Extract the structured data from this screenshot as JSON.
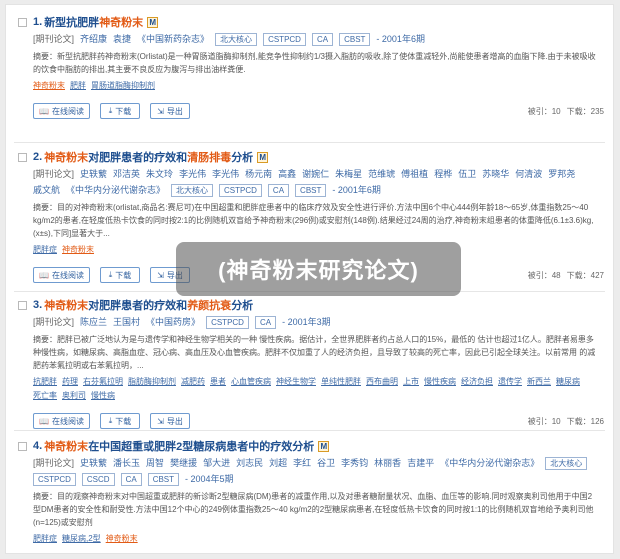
{
  "results": [
    {
      "num": "1.",
      "title_pre": "新型抗肥胖",
      "title_hl": "神奇粉末",
      "title_post": "",
      "title_hl2": "",
      "title_post2": "",
      "badge": "M",
      "meta_label": "[期刊论文]",
      "authors": [
        "齐绍康",
        "袁捷"
      ],
      "journal": "《中国新药杂志》",
      "tags": [
        "北大核心",
        "CSTPCD",
        "CA",
        "CBST"
      ],
      "date": "- 2001年6期",
      "abstract": "摘要：新型抗肥胖药神奇粉末(Orlistat)是一种胃肠道脂酶抑制剂,能竞争性抑制约1/3摄入脂肪的吸收,除了使体重减轻外,尚能使患者增高的血脂下降.由于未被吸收的饮食中脂肪的排出,其主要不良反应为腹泻与排出油样粪便.",
      "keywords": [
        {
          "t": "神奇粉末",
          "hl": true
        },
        {
          "t": "肥胖",
          "hl": false
        },
        {
          "t": "胃肠道脂酶抑制剂",
          "hl": false
        }
      ],
      "btn_read": "在线阅读",
      "btn_dl": "下载",
      "btn_exp": "导出",
      "cited": "被引：10",
      "downloads": "下载：235"
    },
    {
      "num": "2.",
      "title_pre": "",
      "title_hl": "神奇粉末",
      "title_post": "对肥胖患者的疗效和",
      "title_hl2": "清肠排毒",
      "title_post2": "分析",
      "badge": "M",
      "meta_label": "[期刊论文]",
      "authors": [
        "史轶蘩",
        "邓洁英",
        "朱文玲",
        "李光伟",
        "李光伟",
        "杨元南",
        "高鑫",
        "谢婉仁",
        "朱梅星",
        "范维琥",
        "傅祖植",
        "程桦",
        "伍卫",
        "苏晓华",
        "何清波",
        "罗邦尧",
        "戚文航"
      ],
      "journal": "《中华内分泌代谢杂志》",
      "tags": [
        "北大核心",
        "CSTPCD",
        "CA",
        "CBST"
      ],
      "date": "- 2001年6期",
      "abstract": "摘要：目的对神奇粉末(orlistat,商品名:赛尼可)在中国超重和肥胖症患者中的临床疗效及安全性进行评价.方法中国6个中心444例年龄18～65岁,体重指数25～40 kg/m2的患者,在轻度低热卡饮食的同时按2:1的比例随机双盲给予神奇粉末(296例)或安慰剂(148例).结果经过24周的治疗,神奇粉末组患者的体重降低(6.1±3.6)kg,(x±s),下同]显著大于...",
      "keywords": [
        {
          "t": "肥胖症",
          "hl": false
        },
        {
          "t": "神奇粉末",
          "hl": true
        }
      ],
      "btn_read": "在线阅读",
      "btn_dl": "下载",
      "btn_exp": "导出",
      "cited": "被引：48",
      "downloads": "下载：427"
    },
    {
      "num": "3.",
      "title_pre": "",
      "title_hl": "神奇粉末",
      "title_post": "对肥胖患者的疗效和",
      "title_hl2": "养颜抗衰",
      "title_post2": "分析",
      "badge": "",
      "meta_label": "[期刊论文]",
      "authors": [
        "陈应兰",
        "王国村"
      ],
      "journal": "《中国药房》",
      "tags": [
        "CSTPCD",
        "CA"
      ],
      "date": "- 2001年3期",
      "abstract": "摘要：肥胖已被广泛地认为是与遗传学和神经生物学相关的一种 慢性疾病。据估计，全世界肥胖者约占总人口的15%，最低的 估计也超过1亿人。肥胖者易患多种慢性病，如糖尿病、高脂血症、冠心病、高血压及心血管疾病。肥胖不仅加重了人的经济负担，且导致了较高的死亡率，因此已引起全球关注。以前常用 的减肥药苯氟拉明或右苯氟拉明，...",
      "keywords": [
        {
          "t": "抗肥胖",
          "hl": false
        },
        {
          "t": "药理",
          "hl": false
        },
        {
          "t": "右芬氟拉明",
          "hl": false
        },
        {
          "t": "脂肪酶抑制剂",
          "hl": false
        },
        {
          "t": "减肥药",
          "hl": false
        },
        {
          "t": "患者",
          "hl": false
        },
        {
          "t": "心血管疾病",
          "hl": false
        },
        {
          "t": "神经生物学",
          "hl": false
        },
        {
          "t": "单纯性肥胖",
          "hl": false
        },
        {
          "t": "西布曲明",
          "hl": false
        },
        {
          "t": "上市",
          "hl": false
        },
        {
          "t": "慢性疾病",
          "hl": false
        },
        {
          "t": "经济负担",
          "hl": false
        },
        {
          "t": "遗传学",
          "hl": false
        },
        {
          "t": "新西兰",
          "hl": false
        },
        {
          "t": "糖尿病",
          "hl": false
        },
        {
          "t": "死亡率",
          "hl": false
        },
        {
          "t": "奥利司",
          "hl": false
        },
        {
          "t": "慢性病",
          "hl": false
        }
      ],
      "btn_read": "在线阅读",
      "btn_dl": "下载",
      "btn_exp": "导出",
      "cited": "被引：10",
      "downloads": "下载：126"
    },
    {
      "num": "4.",
      "title_pre": "",
      "title_hl": "神奇粉末",
      "title_post": "在中国超重或肥胖2型糖尿病患者中的疗效分析",
      "title_hl2": "",
      "title_post2": "",
      "badge": "M",
      "meta_label": "[期刊论文]",
      "authors": [
        "史轶蘩",
        "潘长玉",
        "周智",
        "樊继援",
        "邹大进",
        "刘志民",
        "刘超",
        "李红",
        "谷卫",
        "李秀钧",
        "林丽香",
        "吉建平"
      ],
      "journal": "《中华内分泌代谢杂志》",
      "tags": [
        "北大核心",
        "CSTPCD",
        "CSCD",
        "CA",
        "CBST"
      ],
      "date": "- 2004年5期",
      "abstract": "摘要：目的观察神奇粉末对中国超重或肥胖的新诊断2型糖尿病(DM)患者的减重作用,以及对患者糖耐量状况、血脂、血压等的影响.同时观察奥利司他用于中国2型DM患者的安全性和耐受性.方法中国12个中心的249例体重指数25～40 kg/m2的2型糖尿病患者,在轻度低热卡饮食的同时按1:1的比例随机双盲地给予奥利司他(n=125)或安慰剂",
      "keywords": [
        {
          "t": "肥胖症",
          "hl": false
        },
        {
          "t": "糖尿病,2型",
          "hl": false
        },
        {
          "t": "神奇粉末",
          "hl": true
        }
      ],
      "btn_read": "在线阅读",
      "btn_dl": "下载",
      "btn_exp": "导出",
      "cited": "",
      "downloads": ""
    }
  ],
  "watermark": "(神奇粉末研究论文)",
  "icons": {
    "read": "book-icon",
    "download": "download-icon",
    "export": "export-icon"
  }
}
